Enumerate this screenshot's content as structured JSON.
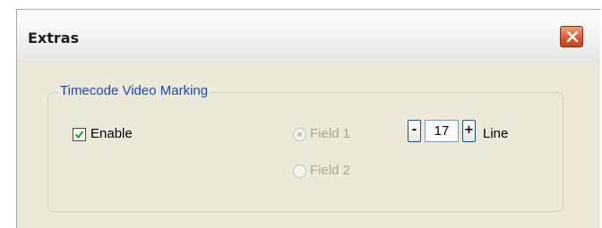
{
  "window": {
    "title": "Extras"
  },
  "group": {
    "label": "Timecode Video Marking"
  },
  "enable": {
    "label": "Enable",
    "checked": true
  },
  "field1": {
    "label": "Field 1",
    "selected": true,
    "enabled": false
  },
  "field2": {
    "label": "Field 2",
    "selected": false,
    "enabled": false
  },
  "line_spinner": {
    "decrement_label": "-",
    "value": "17",
    "increment_label": "+",
    "unit_label": "Line"
  },
  "icons": {
    "close": "close-icon",
    "check": "checkmark-icon"
  },
  "colors": {
    "group_label": "#1e46c8",
    "close_button": "#dd5a32",
    "disabled_text": "#aca899",
    "background": "#ece9d8"
  }
}
